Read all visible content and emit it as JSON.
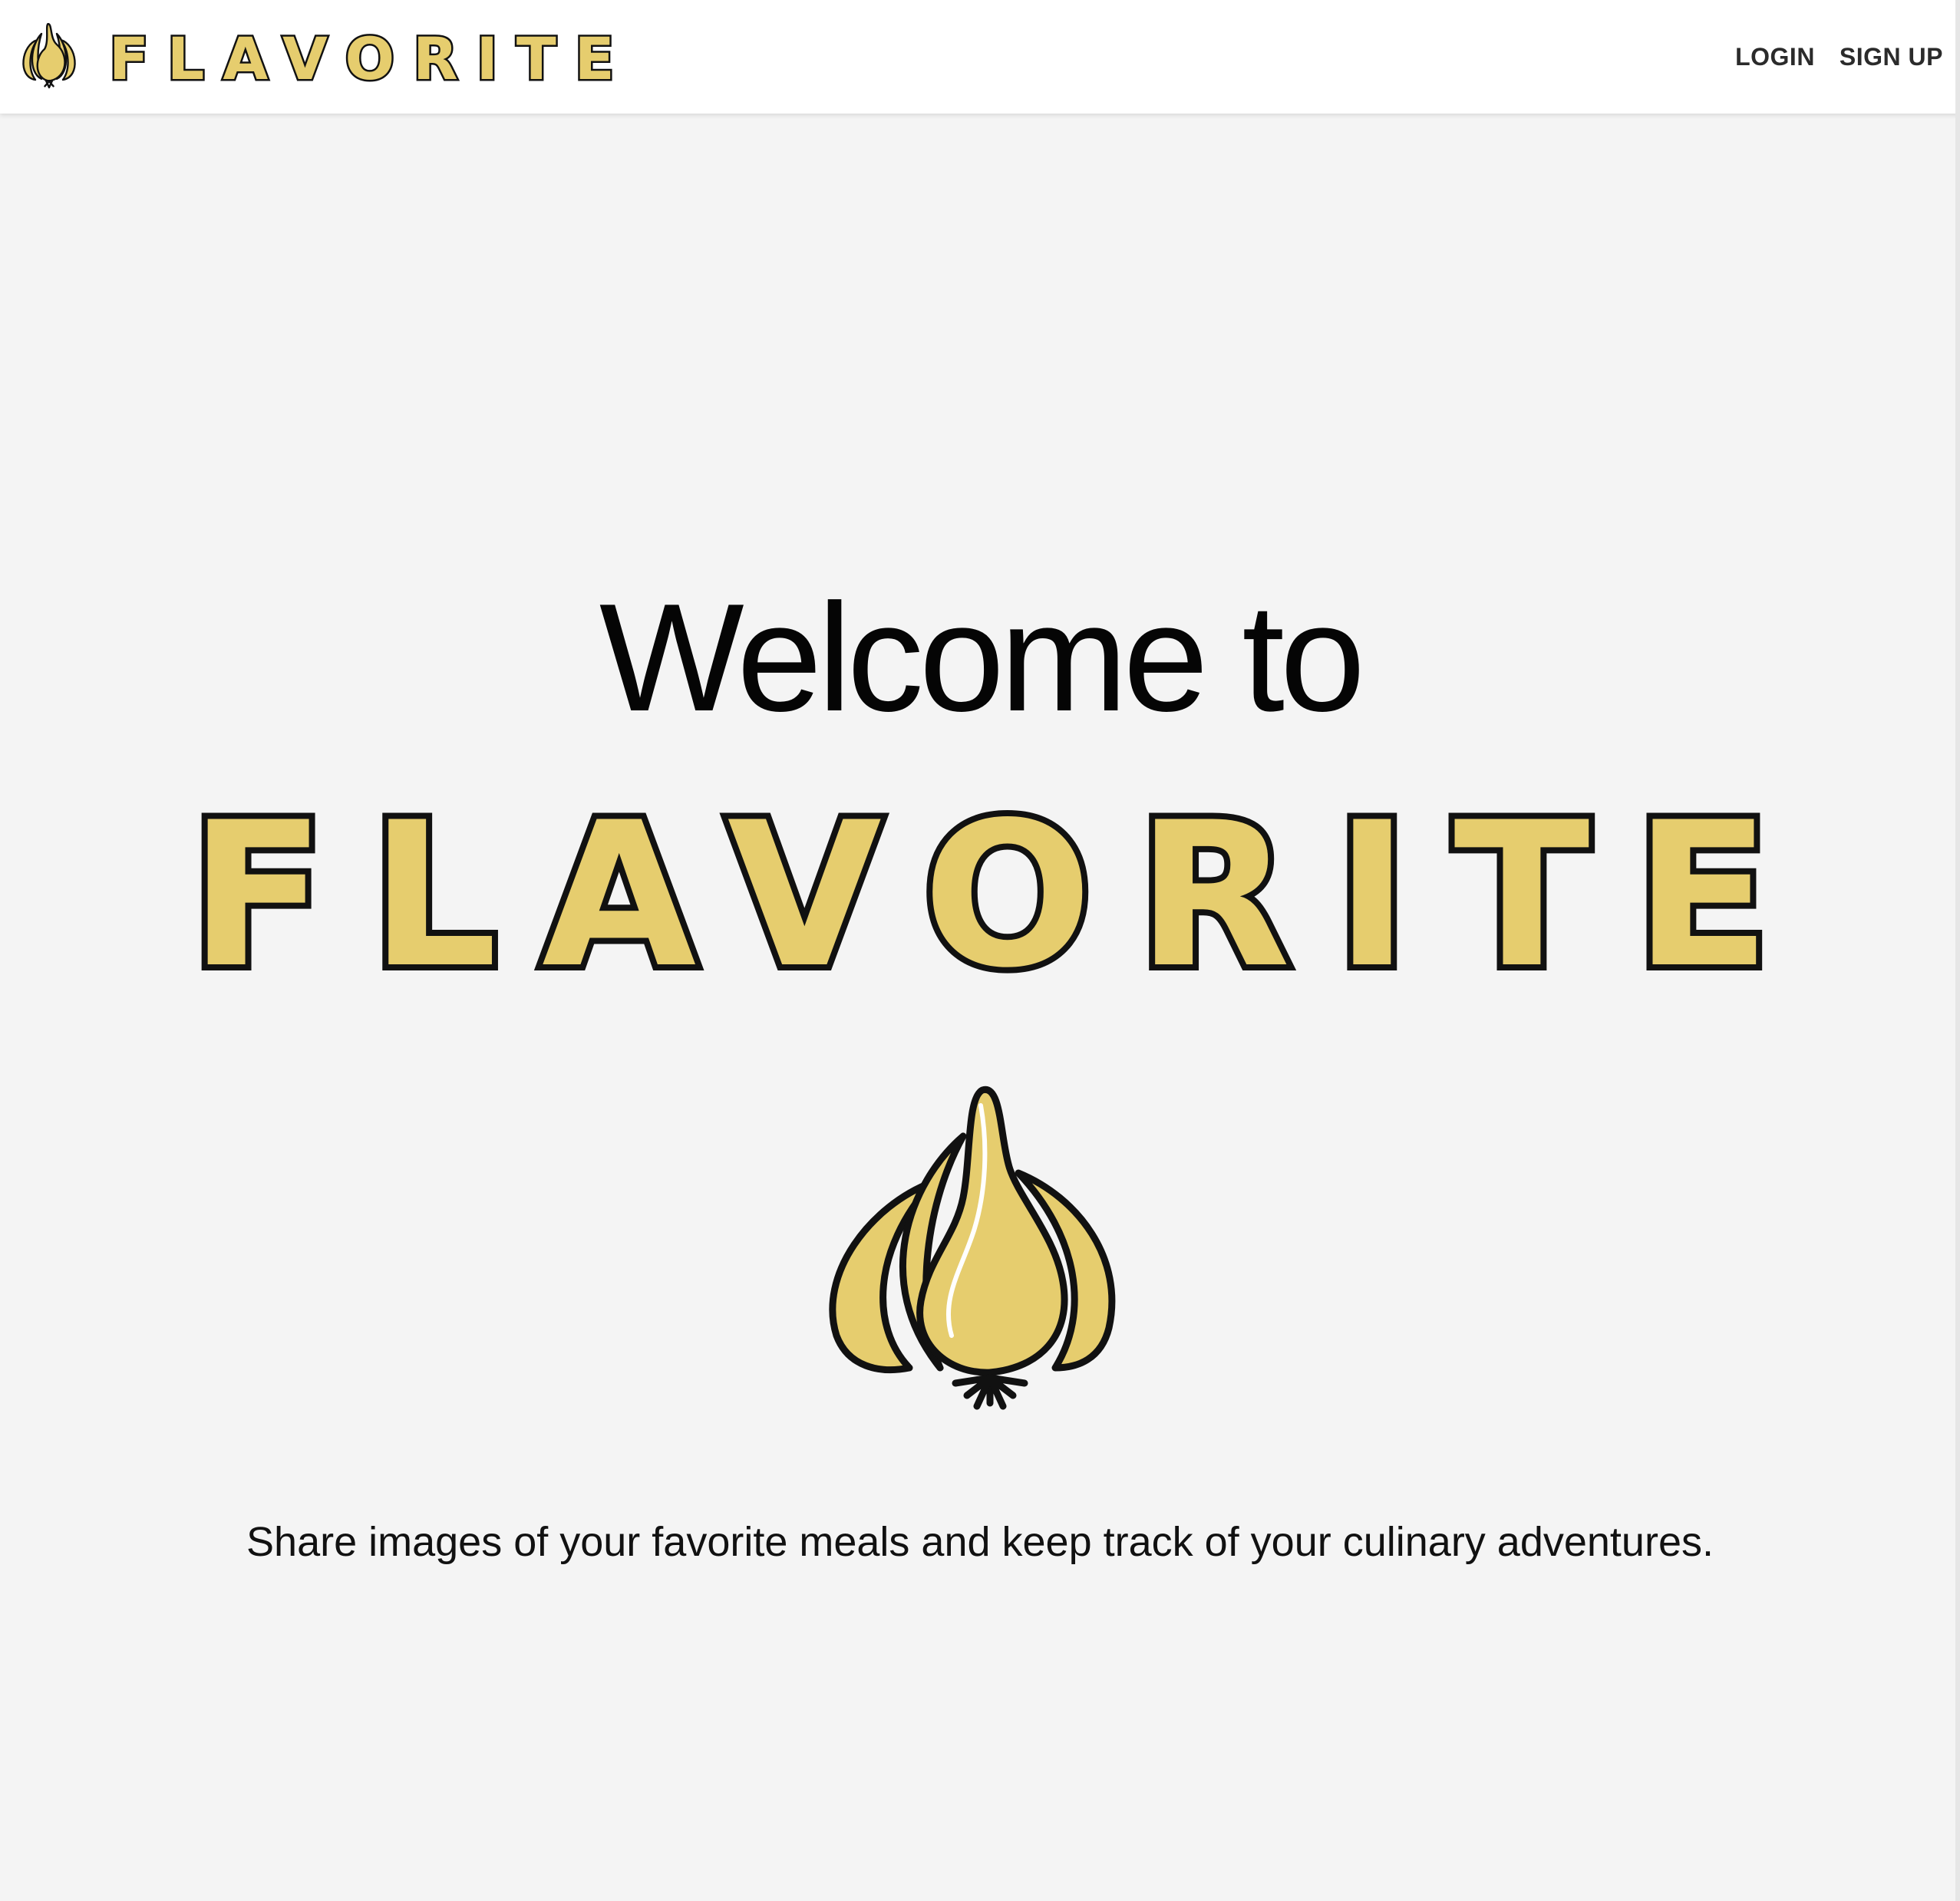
{
  "navbar": {
    "brand_name": "FLAVORITE",
    "brand_icon": "garlic-icon",
    "links": {
      "login": "LOGIN",
      "signup": "SIGN UP"
    }
  },
  "hero": {
    "title": "Welcome to",
    "wordmark": "FLAVORITE",
    "illustration_icon": "garlic-icon",
    "tagline": "Share images of your favorite meals and keep track of your culinary adventures."
  },
  "colors": {
    "brand_yellow": "#e6cd6e",
    "outline": "#111111",
    "page_background": "#f4f4f4",
    "navbar_background": "#ffffff",
    "nav_text": "#2b2b2b"
  }
}
